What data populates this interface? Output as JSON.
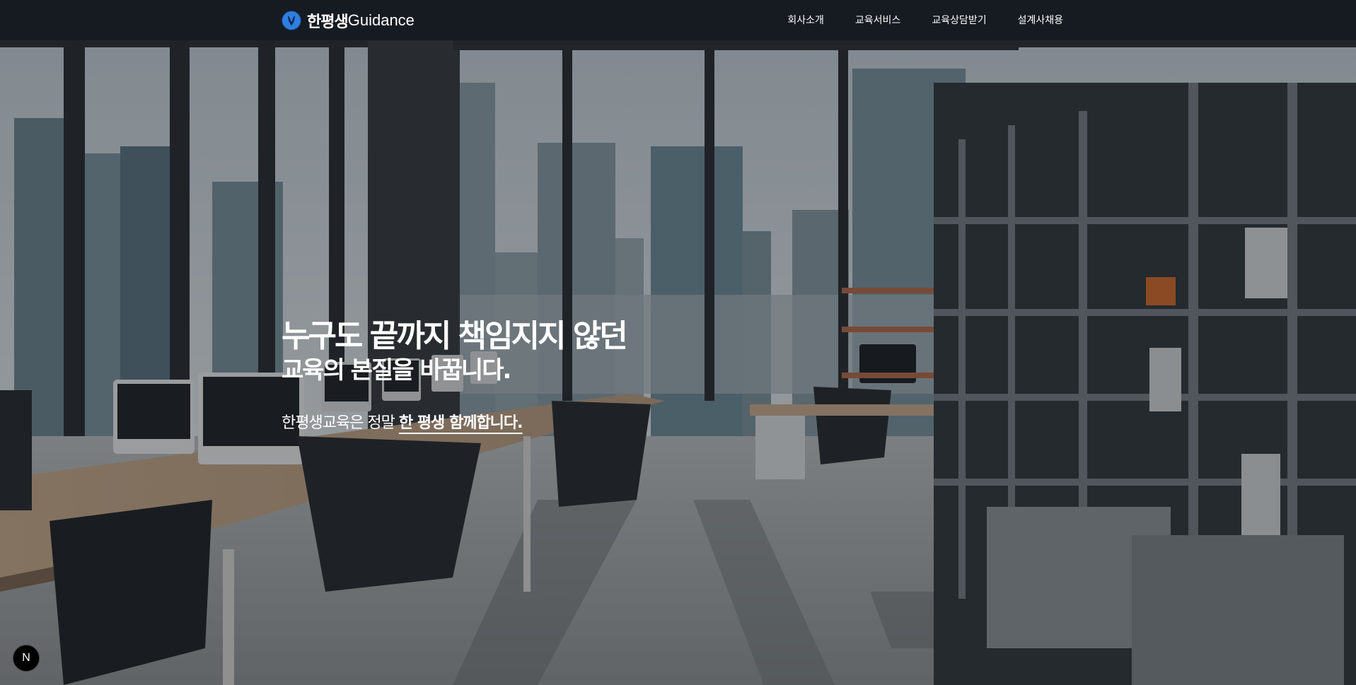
{
  "brand": {
    "name_kr": "한평생",
    "name_en": "Guidance",
    "logo_icon": "globe-logo-icon"
  },
  "nav": {
    "items": [
      {
        "label": "회사소개"
      },
      {
        "label": "교육서비스"
      },
      {
        "label": "교육상담받기"
      },
      {
        "label": "설계사채용"
      }
    ]
  },
  "hero": {
    "headline": "누구도 끝까지 책임지지 않던",
    "subhead": "교육의 본질을 바꿉니다.",
    "tagline_prefix": "한평생교육은 정말 ",
    "tagline_emphasis": "한 평생 함께합니다."
  },
  "devtools_badge": {
    "label": "N",
    "icon": "nextjs-icon"
  },
  "colors": {
    "navbar_bg": "#161b22",
    "text": "#ffffff",
    "logo_blue": "#2f7fe0"
  }
}
